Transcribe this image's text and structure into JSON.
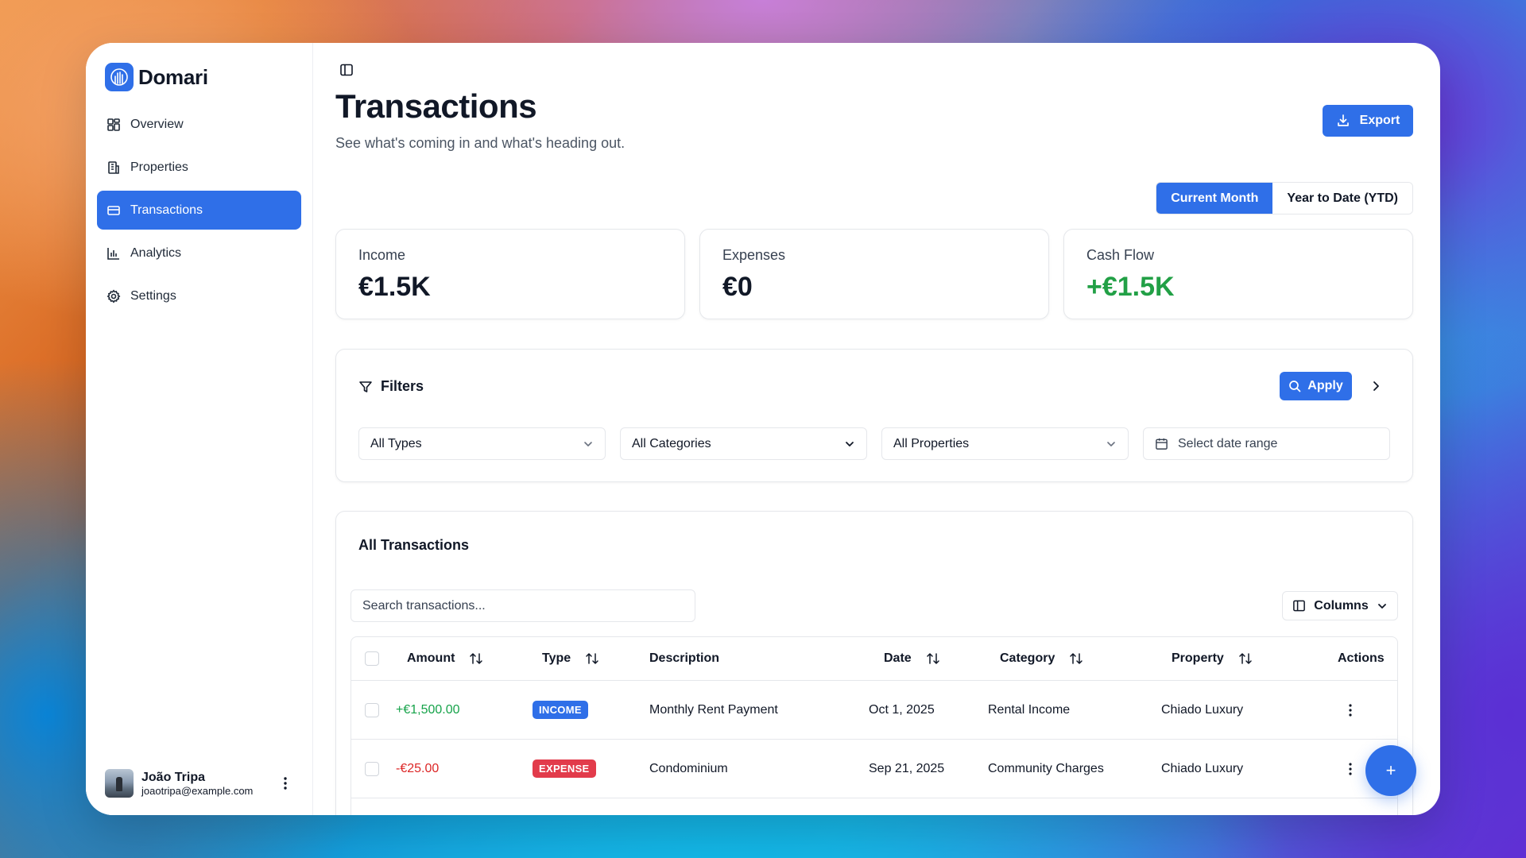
{
  "brand": {
    "name": "Domari",
    "accent": "#2f6fe8"
  },
  "sidebar": {
    "items": [
      {
        "label": "Overview",
        "icon": "dashboard-grid-icon"
      },
      {
        "label": "Properties",
        "icon": "building-icon"
      },
      {
        "label": "Transactions",
        "icon": "credit-card-icon",
        "active": true
      },
      {
        "label": "Analytics",
        "icon": "bar-chart-icon"
      },
      {
        "label": "Settings",
        "icon": "gear-icon"
      }
    ]
  },
  "user": {
    "name": "João Tripa",
    "email": "joaotripa@example.com"
  },
  "header": {
    "title": "Transactions",
    "subtitle": "See what's coming in and what's heading out.",
    "export_label": "Export"
  },
  "period": {
    "options": [
      "Current Month",
      "Year to Date (YTD)"
    ],
    "selected": "Current Month"
  },
  "stats": [
    {
      "label": "Income",
      "value": "€1.5K"
    },
    {
      "label": "Expenses",
      "value": "€0"
    },
    {
      "label": "Cash Flow",
      "value": "+€1.5K",
      "color": "#22a046"
    }
  ],
  "filters": {
    "title": "Filters",
    "apply_label": "Apply",
    "type": "All Types",
    "category": "All Categories",
    "property": "All Properties",
    "date_placeholder": "Select date range"
  },
  "table": {
    "title": "All Transactions",
    "search_placeholder": "Search transactions...",
    "columns_label": "Columns",
    "headers": {
      "amount": "Amount",
      "type": "Type",
      "description": "Description",
      "date": "Date",
      "category": "Category",
      "property": "Property",
      "actions": "Actions"
    },
    "rows": [
      {
        "amount": "+€1,500.00",
        "type": "INCOME",
        "description": "Monthly Rent Payment",
        "date": "Oct 1, 2025",
        "category": "Rental Income",
        "property": "Chiado Luxury"
      },
      {
        "amount": "-€25.00",
        "type": "EXPENSE",
        "description": "Condominium",
        "date": "Sep 21, 2025",
        "category": "Community Charges",
        "property": "Chiado Luxury"
      }
    ]
  },
  "fab": {
    "label": "+"
  }
}
